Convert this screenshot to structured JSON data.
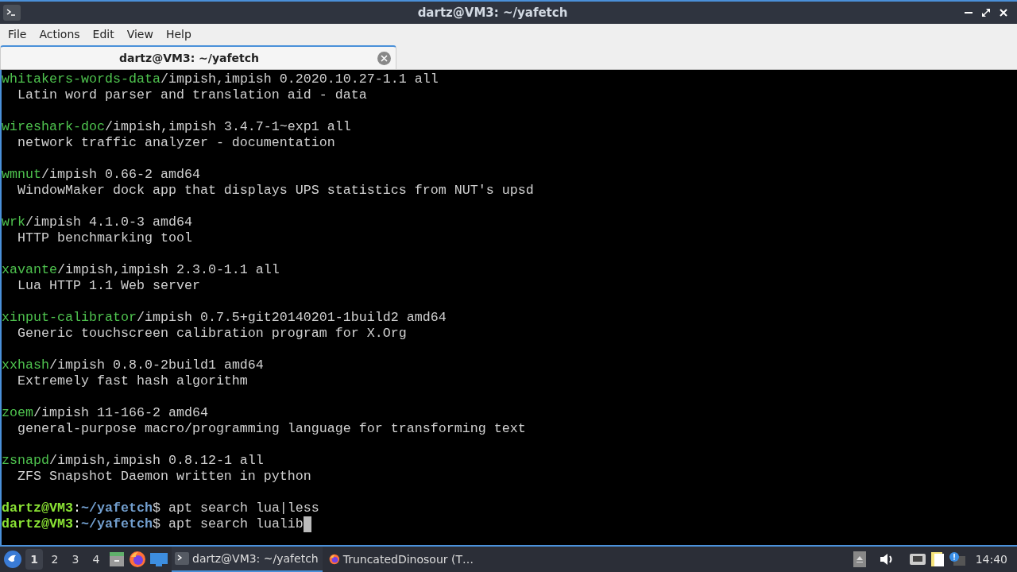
{
  "window": {
    "title": "dartz@VM3: ~/yafetch"
  },
  "menu": [
    "File",
    "Actions",
    "Edit",
    "View",
    "Help"
  ],
  "tabs": [
    {
      "label": "dartz@VM3: ~/yafetch",
      "selected": true
    }
  ],
  "terminal": {
    "packages": [
      {
        "name": "whitakers-words-data",
        "info": "/impish,impish 0.2020.10.27-1.1 all",
        "description": "  Latin word parser and translation aid - data"
      },
      {
        "name": "wireshark-doc",
        "info": "/impish,impish 3.4.7-1~exp1 all",
        "description": "  network traffic analyzer - documentation"
      },
      {
        "name": "wmnut",
        "info": "/impish 0.66-2 amd64",
        "description": "  WindowMaker dock app that displays UPS statistics from NUT's upsd"
      },
      {
        "name": "wrk",
        "info": "/impish 4.1.0-3 amd64",
        "description": "  HTTP benchmarking tool"
      },
      {
        "name": "xavante",
        "info": "/impish,impish 2.3.0-1.1 all",
        "description": "  Lua HTTP 1.1 Web server"
      },
      {
        "name": "xinput-calibrator",
        "info": "/impish 0.7.5+git20140201-1build2 amd64",
        "description": "  Generic touchscreen calibration program for X.Org"
      },
      {
        "name": "xxhash",
        "info": "/impish 0.8.0-2build1 amd64",
        "description": "  Extremely fast hash algorithm"
      },
      {
        "name": "zoem",
        "info": "/impish 11-166-2 amd64",
        "description": "  general-purpose macro/programming language for transforming text"
      },
      {
        "name": "zsnapd",
        "info": "/impish,impish 0.8.12-1 all",
        "description": "  ZFS Snapshot Daemon written in python"
      }
    ],
    "prompts": [
      {
        "user_host": "dartz@VM3",
        "colon": ":",
        "path": "~/yafetch",
        "sigil": "$",
        "command": "apt search lua|less",
        "cursor": false
      },
      {
        "user_host": "dartz@VM3",
        "colon": ":",
        "path": "~/yafetch",
        "sigil": "$",
        "command": "apt search lualib",
        "cursor": true
      }
    ]
  },
  "taskbar": {
    "workspaces": [
      {
        "label": "1",
        "selected": true
      },
      {
        "label": "2",
        "selected": false
      },
      {
        "label": "3",
        "selected": false
      },
      {
        "label": "4",
        "selected": false
      }
    ],
    "tasks": [
      {
        "kind": "terminal",
        "label": "dartz@VM3: ~/yafetch",
        "selected": true
      },
      {
        "kind": "browser",
        "label": "TruncatedDinosour (T…",
        "selected": false
      }
    ],
    "clock": "14:40"
  }
}
